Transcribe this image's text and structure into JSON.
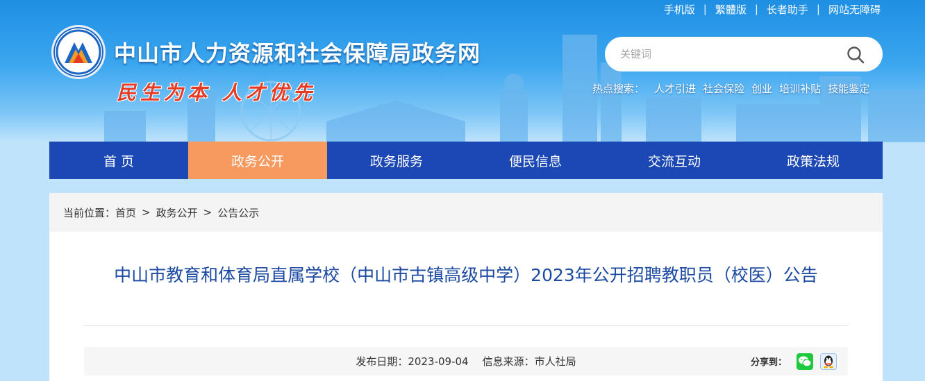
{
  "top_links": [
    "手机版",
    "繁體版",
    "长者助手",
    "网站无障碍"
  ],
  "site": {
    "title": "中山市人力资源和社会保障局政务网",
    "slogan": "民生为本 人才优先"
  },
  "search": {
    "placeholder": "关键词",
    "hot_label": "热点搜索：",
    "hot_terms": [
      "人才引进",
      "社会保险",
      "创业",
      "培训补贴",
      "技能鉴定"
    ]
  },
  "nav": {
    "items": [
      "首 页",
      "政务公开",
      "政务服务",
      "便民信息",
      "交流互动",
      "政策法规"
    ],
    "active_index": 1
  },
  "breadcrumb": {
    "label": "当前位置：",
    "items": [
      "首页",
      "政务公开",
      "公告公示"
    ],
    "separator": ">"
  },
  "article": {
    "title": "中山市教育和体育局直属学校（中山市古镇高级中学）2023年公开招聘教职员（校医）公告",
    "date_label": "发布日期：",
    "date": "2023-09-04",
    "source_label": "信息来源：",
    "source": "市人社局",
    "share_label": "分享到："
  },
  "icons": {
    "search": "search-icon",
    "wechat": "wechat-icon",
    "qq": "qq-icon",
    "logo": "emblem-logo"
  },
  "colors": {
    "nav_bg": "#1b48b4",
    "nav_active": "#f79a5f",
    "title_blue": "#1c4aa2",
    "slogan_red": "#e53a24"
  }
}
